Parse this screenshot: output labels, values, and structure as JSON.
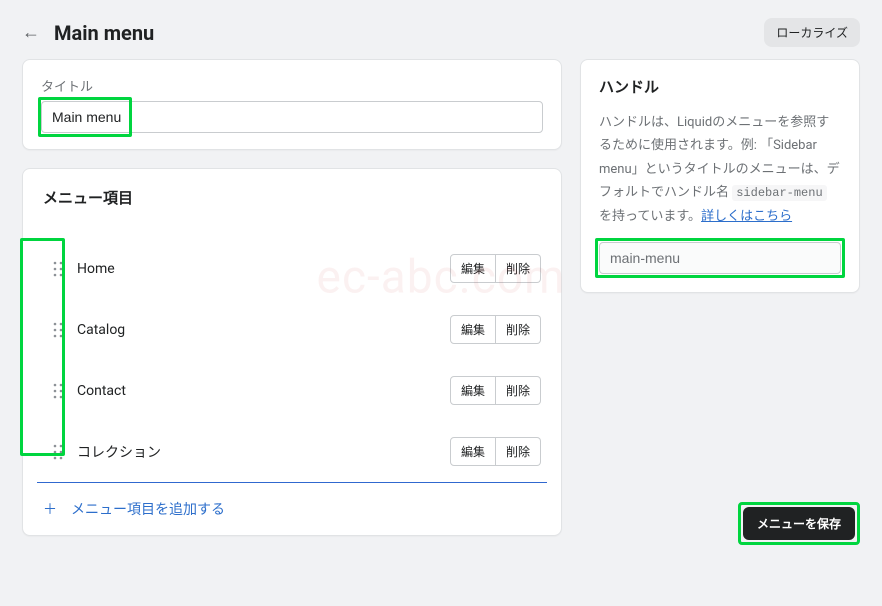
{
  "header": {
    "title": "Main menu",
    "localize_label": "ローカライズ"
  },
  "title_card": {
    "label": "タイトル",
    "value": "Main menu"
  },
  "menu_card": {
    "heading": "メニュー項目",
    "edit_label": "編集",
    "delete_label": "削除",
    "add_label": "メニュー項目を追加する",
    "items": [
      {
        "label": "Home"
      },
      {
        "label": "Catalog"
      },
      {
        "label": "Contact"
      },
      {
        "label": "コレクション"
      }
    ]
  },
  "handle_card": {
    "heading": "ハンドル",
    "desc_prefix": "ハンドルは、Liquidのメニューを参照するために使用されます。例: 「Sidebar menu」というタイトルのメニューは、デフォルトでハンドル名 ",
    "desc_code": "sidebar-menu",
    "desc_suffix": " を持っています。",
    "link_label": "詳しくはこちら",
    "value": "main-menu"
  },
  "footer": {
    "save_label": "メニューを保存"
  },
  "watermark": "ec-abc.com",
  "highlight_color": "#00d53f"
}
